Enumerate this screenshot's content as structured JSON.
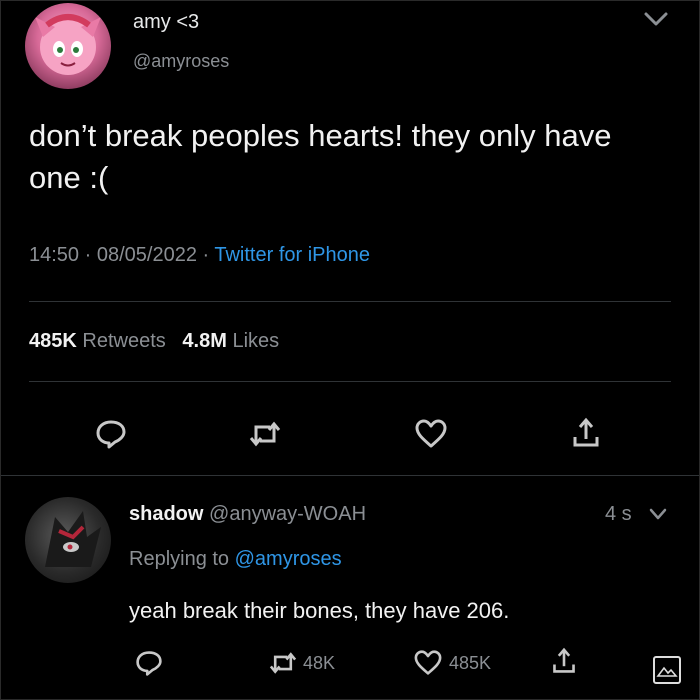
{
  "tweet": {
    "display_name": "amy <3",
    "handle": "@amyroses",
    "text": "don’t break peoples hearts! they only have one :(",
    "time": "14:50",
    "date": "08/05/2022",
    "source": "Twitter for iPhone",
    "retweets_count": "485K",
    "retweets_label": "Retweets",
    "likes_count": "4.8M",
    "likes_label": "Likes",
    "actions": [
      "reply-icon",
      "retweet-icon",
      "heart-icon",
      "share-icon"
    ]
  },
  "reply": {
    "display_name": "shadow",
    "handle": "@anyway-WOAH",
    "time": "4 s",
    "replying_prefix": "Replying to",
    "replying_to": "@amyroses",
    "text": "yeah break their bones, they have 206.",
    "retweets": "48K",
    "likes": "485K",
    "actions": [
      "reply-icon",
      "retweet-icon",
      "heart-icon",
      "share-icon"
    ]
  },
  "colors": {
    "background": "#000000",
    "primary_text": "#e7e9ea",
    "secondary_text": "#8b8f94",
    "link": "#2f96e6",
    "divider": "#2f3336"
  }
}
